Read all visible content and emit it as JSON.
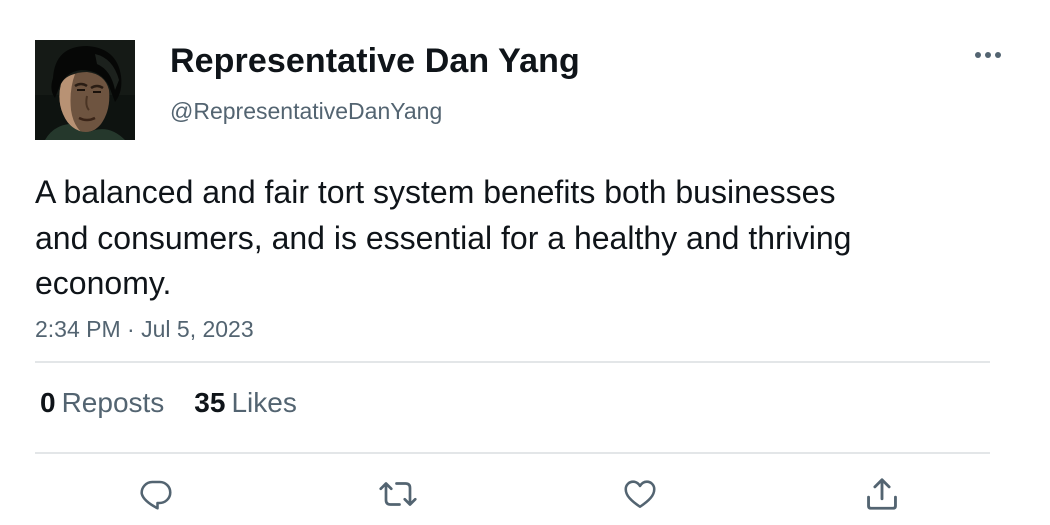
{
  "author": {
    "display_name": "Representative Dan Yang",
    "handle": "@RepresentativeDanYang"
  },
  "tweet": {
    "text": "A balanced and fair tort system benefits both businesses and consumers, and is essential for a healthy and thriving economy.",
    "time": "2:34 PM",
    "separator": "·",
    "date": "Jul 5, 2023"
  },
  "stats": {
    "reposts_count": "0",
    "reposts_label": "Reposts",
    "likes_count": "35",
    "likes_label": "Likes"
  },
  "actions": {
    "reply_icon": "reply-icon",
    "repost_icon": "repost-icon",
    "like_icon": "heart-icon",
    "share_icon": "share-icon"
  },
  "colors": {
    "primary_text": "#0f1419",
    "secondary_text": "#536471",
    "divider": "#e3e6e8"
  }
}
